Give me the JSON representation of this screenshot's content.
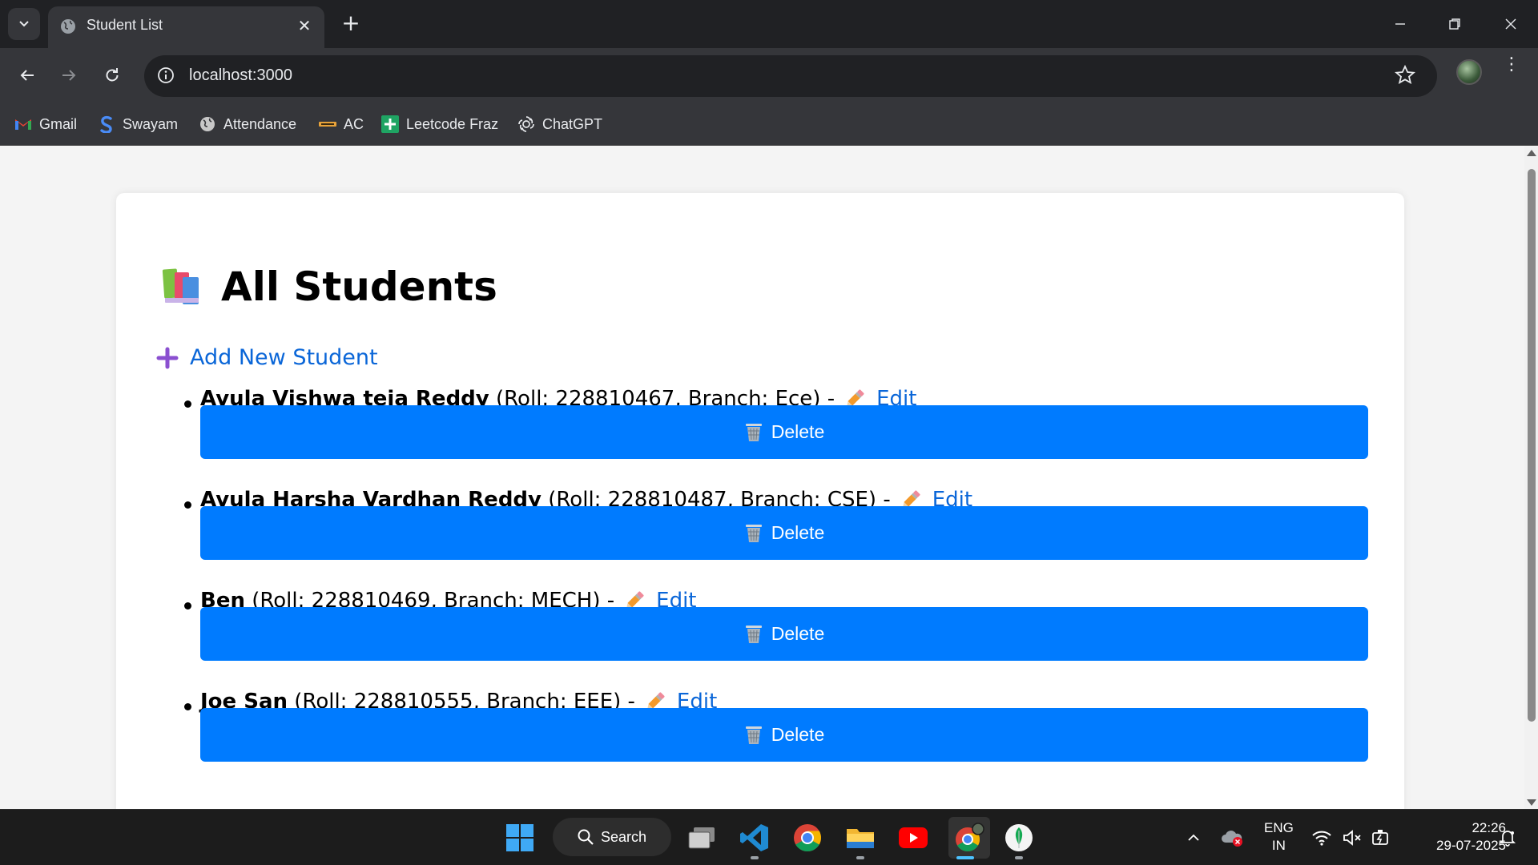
{
  "browser": {
    "tab_title": "Student List",
    "url": "localhost:3000",
    "bookmarks": [
      {
        "label": "Gmail",
        "icon": "gmail-icon"
      },
      {
        "label": "Swayam",
        "icon": "swayam-icon"
      },
      {
        "label": "Attendance",
        "icon": "globe-icon"
      },
      {
        "label": "AC",
        "icon": "ac-icon"
      },
      {
        "label": "Leetcode Fraz",
        "icon": "green-plus-icon"
      },
      {
        "label": "ChatGPT",
        "icon": "chatgpt-icon"
      }
    ]
  },
  "page": {
    "heading": "All Students",
    "add_link": "Add New Student",
    "students": [
      {
        "name": "Avula Vishwa teja Reddy",
        "details": "(Roll: 228810467, Branch: Ece) -",
        "edit_label": "Edit",
        "delete_label": "Delete"
      },
      {
        "name": "Avula Harsha Vardhan Reddy",
        "details": "(Roll: 228810487, Branch: CSE) -",
        "edit_label": "Edit",
        "delete_label": "Delete"
      },
      {
        "name": "Ben",
        "details": "(Roll: 228810469, Branch: MECH) -",
        "edit_label": "Edit",
        "delete_label": "Delete"
      },
      {
        "name": "Joe San",
        "details": "(Roll: 228810555, Branch: EEE) -",
        "edit_label": "Edit",
        "delete_label": "Delete"
      }
    ]
  },
  "taskbar": {
    "search_label": "Search",
    "language_line1": "ENG",
    "language_line2": "IN",
    "time": "22:26",
    "date": "29-07-2025"
  },
  "colors": {
    "primary_button": "#007bff",
    "link": "#0a66d8",
    "chrome_dark": "#202124",
    "chrome_toolbar": "#35363a"
  }
}
